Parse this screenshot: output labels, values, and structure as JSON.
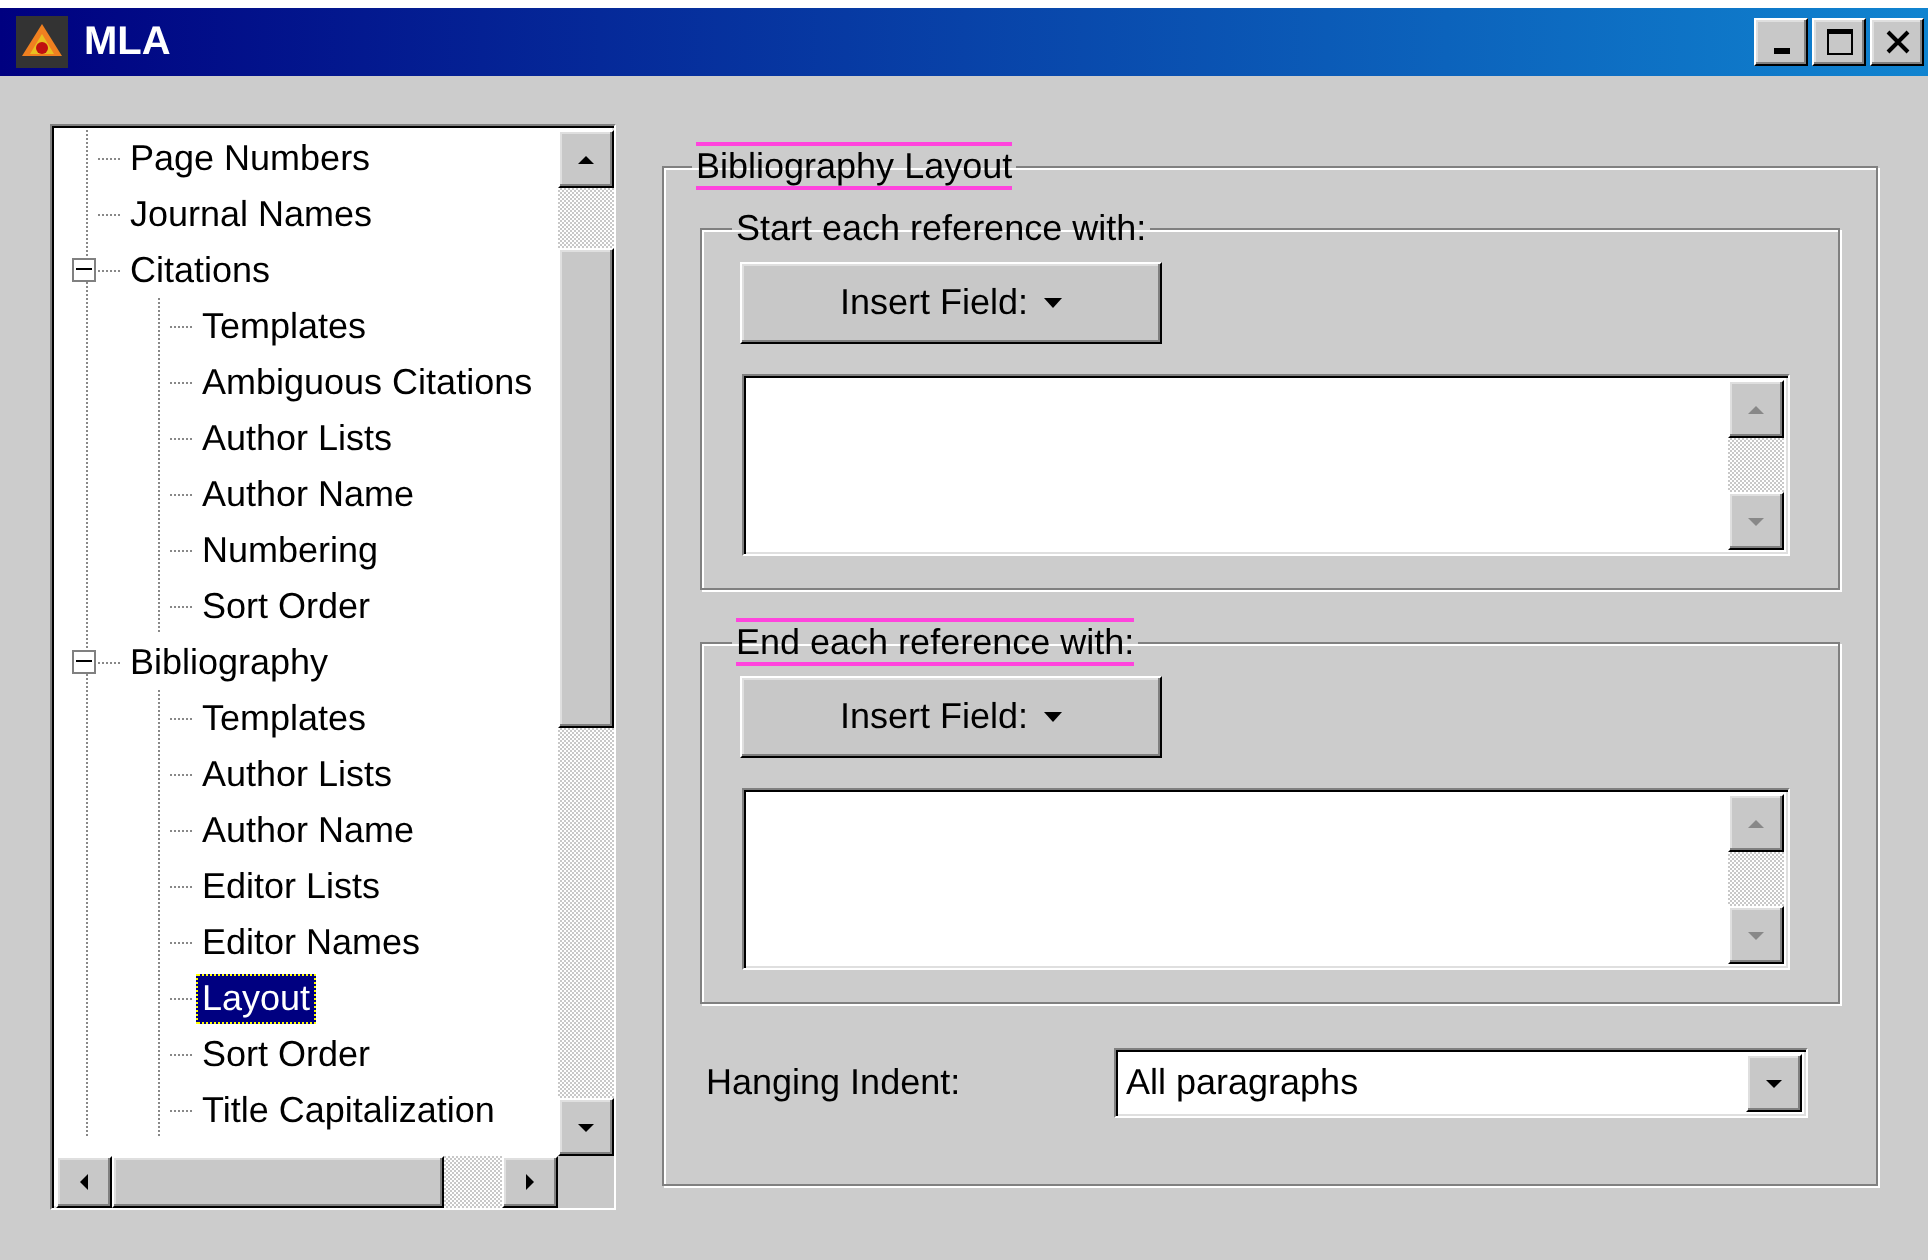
{
  "window": {
    "title": "MLA"
  },
  "tree": {
    "items": [
      {
        "label": "Page Numbers",
        "selected": false
      },
      {
        "label": "Journal Names",
        "selected": false
      },
      {
        "label": "Citations",
        "selected": false,
        "expanded": true,
        "children": [
          {
            "label": "Templates",
            "selected": false
          },
          {
            "label": "Ambiguous Citations",
            "selected": false
          },
          {
            "label": "Author Lists",
            "selected": false
          },
          {
            "label": "Author Name",
            "selected": false
          },
          {
            "label": "Numbering",
            "selected": false
          },
          {
            "label": "Sort Order",
            "selected": false
          }
        ]
      },
      {
        "label": "Bibliography",
        "selected": false,
        "expanded": true,
        "children": [
          {
            "label": "Templates",
            "selected": false
          },
          {
            "label": "Author Lists",
            "selected": false
          },
          {
            "label": "Author Name",
            "selected": false
          },
          {
            "label": "Editor Lists",
            "selected": false
          },
          {
            "label": "Editor Names",
            "selected": false
          },
          {
            "label": "Layout",
            "selected": true
          },
          {
            "label": "Sort Order",
            "selected": false
          },
          {
            "label": "Title Capitalization",
            "selected": false
          }
        ]
      }
    ]
  },
  "layout_group": {
    "title": "Bibliography Layout",
    "highlighted": true,
    "sections": [
      {
        "title": "Start each reference with:",
        "highlighted": false,
        "button": {
          "label": "Insert Field:"
        }
      },
      {
        "title": "End each reference with:",
        "highlighted": true,
        "button": {
          "label": "Insert Field:"
        }
      }
    ],
    "hanging_indent": {
      "label": "Hanging Indent:",
      "value": "All paragraphs"
    }
  }
}
